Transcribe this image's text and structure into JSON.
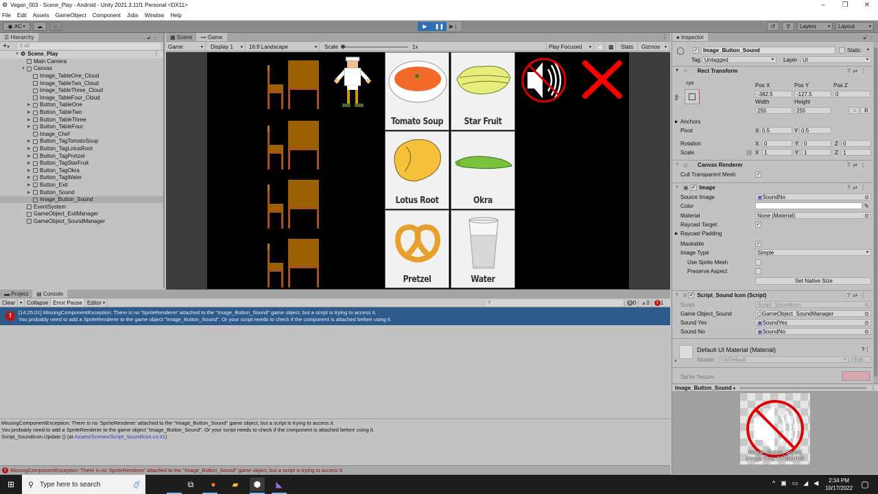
{
  "window": {
    "title": "Vegan_003 - Scene_Play - Android - Unity 2021.3.11f1 Personal <DX11>",
    "controls": [
      "minimize",
      "restore",
      "close"
    ]
  },
  "menu": [
    "File",
    "Edit",
    "Assets",
    "GameObject",
    "Component",
    "Jobs",
    "Window",
    "Help"
  ],
  "toolbar": {
    "account": "AC",
    "layers": "Layers",
    "layout": "Layout"
  },
  "hierarchy": {
    "tab": "Hierarchy",
    "search_placeholder": "All",
    "scene": "Scene_Play",
    "items": [
      {
        "label": "Main Camera",
        "depth": 1,
        "expand": ""
      },
      {
        "label": "Canvas",
        "depth": 1,
        "expand": "open"
      },
      {
        "label": "Image_TableOne_Cloud",
        "depth": 2,
        "expand": ""
      },
      {
        "label": "Image_TableTwo_Cloud",
        "depth": 2,
        "expand": ""
      },
      {
        "label": "Image_TableThree_Cloud",
        "depth": 2,
        "expand": ""
      },
      {
        "label": "Image_TableFour_Cloud",
        "depth": 2,
        "expand": ""
      },
      {
        "label": "Button_TableOne",
        "depth": 2,
        "expand": "closed"
      },
      {
        "label": "Button_TableTwo",
        "depth": 2,
        "expand": "closed"
      },
      {
        "label": "Button_TableThree",
        "depth": 2,
        "expand": "closed"
      },
      {
        "label": "Button_TableFour",
        "depth": 2,
        "expand": "closed"
      },
      {
        "label": "Image_Chef",
        "depth": 2,
        "expand": ""
      },
      {
        "label": "Button_TagTomatoSoup",
        "depth": 2,
        "expand": "closed"
      },
      {
        "label": "Button_TagLotusRoot",
        "depth": 2,
        "expand": "closed"
      },
      {
        "label": "Button_TagPretzel",
        "depth": 2,
        "expand": "closed"
      },
      {
        "label": "Button_TagStarFruit",
        "depth": 2,
        "expand": "closed"
      },
      {
        "label": "Button_TagOkra",
        "depth": 2,
        "expand": "closed"
      },
      {
        "label": "Button_TagWater",
        "depth": 2,
        "expand": "closed"
      },
      {
        "label": "Button_Exit",
        "depth": 2,
        "expand": "closed"
      },
      {
        "label": "Button_Sound",
        "depth": 2,
        "expand": "closed"
      },
      {
        "label": "Image_Button_Sound",
        "depth": 2,
        "expand": "",
        "selected": true
      },
      {
        "label": "EventSystem",
        "depth": 1,
        "expand": ""
      },
      {
        "label": "GameObject_ExitManager",
        "depth": 1,
        "expand": ""
      },
      {
        "label": "GameObject_SoundManager",
        "depth": 1,
        "expand": ""
      }
    ]
  },
  "scene_tabs": [
    "Scene",
    "Game"
  ],
  "game_toolbar": {
    "mode": "Game",
    "display": "Display 1",
    "aspect": "16:9 Landscape",
    "scale_label": "Scale",
    "scale_value": "1x",
    "play_focused": "Play Focused",
    "stats": "Stats",
    "gizmos": "Gizmos"
  },
  "game": {
    "cards": [
      "Tomato Soup",
      "Star Fruit",
      "Lotus Root",
      "Okra",
      "Pretzel",
      "Water"
    ],
    "table_count": 4
  },
  "console": {
    "tabs": [
      "Project",
      "Console"
    ],
    "buttons": [
      "Clear",
      "Collapse",
      "Error Pause",
      "Editor"
    ],
    "search_placeholder": "",
    "counts": {
      "info": "0",
      "warning": "0",
      "error": "1"
    },
    "message_line1": "[14:25:01] MissingComponentException: There is no 'SpriteRenderer' attached to the \"Image_Button_Sound\" game object, but a script is trying to access it.",
    "message_line2": "You probably need to add a SpriteRenderer to the game object \"Image_Button_Sound\". Or your script needs to check if the component is attached before using it.",
    "detail_line1": "MissingComponentException: There is no 'SpriteRenderer' attached to the \"Image_Button_Sound\" game object, but a script is trying to access it.",
    "detail_line2": "You probably need to add a SpriteRenderer to the game object \"Image_Button_Sound\". Or your script needs to check if the component is attached before using it.",
    "detail_line3_prefix": "Script_SoundIcon.Update () (at ",
    "detail_link": "Assets/Scenes/Script_SoundIcon.cs:31",
    "detail_line3_suffix": ")",
    "status": "MissingComponentException: There is no 'SpriteRenderer' attached to the \"Image_Button_Sound\" game object, but a script is trying to access it."
  },
  "inspector": {
    "tab": "Inspector",
    "object_name": "Image_Button_Sound",
    "static_label": "Static",
    "tag_label": "Tag",
    "tag": "Untagged",
    "layer_label": "Layer",
    "layer": "UI",
    "rect_transform": {
      "title": "Rect Transform",
      "anchor_h": "right",
      "anchor_v": "top",
      "pos_x_label": "Pos X",
      "pos_x": "-382.5",
      "pos_y_label": "Pos Y",
      "pos_y": "-127.5",
      "pos_z_label": "Pos Z",
      "pos_z": "0",
      "width_label": "Width",
      "width": "255",
      "height_label": "Height",
      "height": "255",
      "r_label": "R",
      "anchors": "Anchors",
      "pivot": "Pivot",
      "pivot_x": "0.5",
      "pivot_y": "0.5",
      "rotation": "Rotation",
      "rot_x": "0",
      "rot_y": "0",
      "rot_z": "0",
      "scale": "Scale",
      "scale_x": "1",
      "scale_y": "1",
      "scale_z": "1"
    },
    "canvas_renderer": {
      "title": "Canvas Renderer",
      "cull_label": "Cull Transparent Mesh"
    },
    "image": {
      "title": "Image",
      "source_label": "Source Image",
      "source": "SoundNo",
      "color_label": "Color",
      "material_label": "Material",
      "material": "None (Material)",
      "raycast_label": "Raycast Target",
      "raycast_padding": "Raycast Padding",
      "maskable_label": "Maskable",
      "type_label": "Image Type",
      "type": "Simple",
      "sprite_mesh_label": "Use Sprite Mesh",
      "preserve_label": "Preserve Aspect",
      "native_button": "Set Native Size"
    },
    "script": {
      "title": "Script_Sound Icon (Script)",
      "script_label": "Script",
      "script": "Script_SoundIcon",
      "go_label": "Game Object_Sound",
      "go": "GameObject_SoundManager",
      "yes_label": "Sound Yes",
      "yes": "SoundYes",
      "no_label": "Sound No",
      "no": "SoundNo"
    },
    "material": {
      "title": "Default UI Material (Material)",
      "shader_label": "Shader",
      "shader": "UI/Default",
      "edit": "Edit..."
    },
    "sprite_texture": "Sprite Texture",
    "preview": {
      "title": "Image_Button_Sound",
      "caption1": "Image_Button_Sound",
      "caption2": "Image Size: 1000x1000"
    }
  },
  "taskbar": {
    "search_placeholder": "Type here to search",
    "time": "2:34 PM",
    "date": "10/17/2022"
  }
}
